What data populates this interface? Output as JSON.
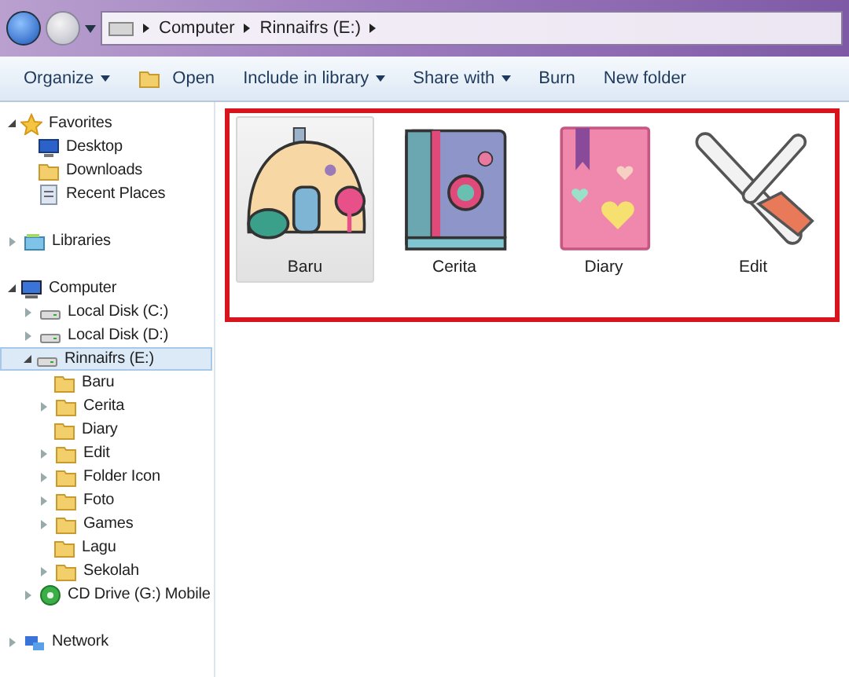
{
  "address_bar": {
    "breadcrumbs": [
      "Computer",
      "Rinnaifrs (E:)"
    ]
  },
  "toolbar": [
    {
      "label": "Organize",
      "dropdown": true
    },
    {
      "label": "Open",
      "dropdown": false
    },
    {
      "label": "Include in library",
      "dropdown": true
    },
    {
      "label": "Share with",
      "dropdown": true
    },
    {
      "label": "Burn",
      "dropdown": false
    },
    {
      "label": "New folder",
      "dropdown": false
    }
  ],
  "sidebar": {
    "tree": [
      {
        "label": "Favorites",
        "kind": "star",
        "expandable": true,
        "expanded": true,
        "selected": false,
        "children": [
          {
            "label": "Desktop",
            "kind": "monitor",
            "expandable": false,
            "selected": false
          },
          {
            "label": "Downloads",
            "kind": "folder",
            "expandable": false,
            "selected": false
          },
          {
            "label": "Recent Places",
            "kind": "recent",
            "expandable": false,
            "selected": false
          }
        ]
      },
      {
        "label": "Libraries",
        "kind": "library",
        "expandable": true,
        "expanded": false,
        "selected": false
      },
      {
        "label": "Computer",
        "kind": "computer",
        "expandable": true,
        "expanded": true,
        "selected": false,
        "children": [
          {
            "label": "Local Disk (C:)",
            "kind": "disk",
            "expandable": true,
            "expanded": false,
            "selected": false
          },
          {
            "label": "Local Disk (D:)",
            "kind": "disk",
            "expandable": true,
            "expanded": false,
            "selected": false
          },
          {
            "label": "Rinnaifrs (E:)",
            "kind": "disk",
            "expandable": true,
            "expanded": true,
            "selected": true,
            "children": [
              {
                "label": "Baru",
                "kind": "folder",
                "expandable": false,
                "selected": false
              },
              {
                "label": "Cerita",
                "kind": "folder",
                "expandable": true,
                "expanded": false,
                "selected": false
              },
              {
                "label": "Diary",
                "kind": "folder",
                "expandable": false,
                "selected": false
              },
              {
                "label": "Edit",
                "kind": "folder",
                "expandable": true,
                "expanded": false,
                "selected": false
              },
              {
                "label": "Folder Icon",
                "kind": "folder",
                "expandable": true,
                "expanded": false,
                "selected": false
              },
              {
                "label": "Foto",
                "kind": "folder",
                "expandable": true,
                "expanded": false,
                "selected": false
              },
              {
                "label": "Games",
                "kind": "folder",
                "expandable": true,
                "expanded": false,
                "selected": false
              },
              {
                "label": "Lagu",
                "kind": "folder",
                "expandable": false,
                "selected": false
              },
              {
                "label": "Sekolah",
                "kind": "folder",
                "expandable": true,
                "expanded": false,
                "selected": false
              }
            ]
          },
          {
            "label": "CD Drive (G:) Mobile",
            "kind": "disc",
            "expandable": true,
            "expanded": false,
            "selected": false
          }
        ]
      },
      {
        "label": "Network",
        "kind": "network",
        "expandable": true,
        "expanded": false,
        "selected": false
      }
    ]
  },
  "folders": [
    {
      "label": "Baru",
      "kind": "house",
      "selected": true
    },
    {
      "label": "Cerita",
      "kind": "book",
      "selected": false
    },
    {
      "label": "Diary",
      "kind": "diary",
      "selected": false
    },
    {
      "label": "Edit",
      "kind": "tools",
      "selected": false
    }
  ]
}
